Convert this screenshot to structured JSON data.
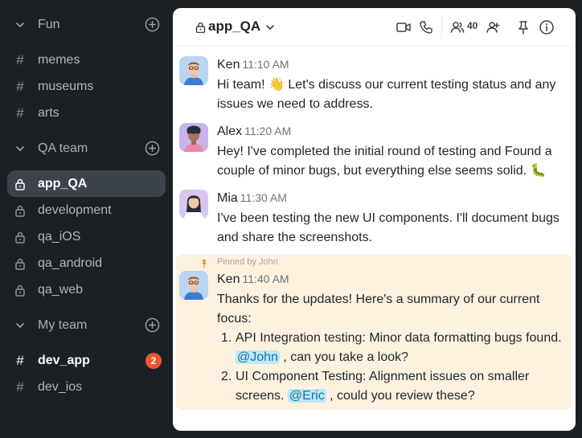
{
  "sidebar": {
    "sections": [
      {
        "title": "Fun",
        "channels": [
          {
            "name": "memes",
            "type": "public"
          },
          {
            "name": "museums",
            "type": "public"
          },
          {
            "name": "arts",
            "type": "public"
          }
        ]
      },
      {
        "title": "QA team",
        "channels": [
          {
            "name": "app_QA",
            "type": "private",
            "active": true
          },
          {
            "name": "development",
            "type": "private"
          },
          {
            "name": "qa_iOS",
            "type": "private"
          },
          {
            "name": "qa_android",
            "type": "private"
          },
          {
            "name": "qa_web",
            "type": "private"
          }
        ]
      },
      {
        "title": "My team",
        "channels": [
          {
            "name": "dev_app",
            "type": "public",
            "unread": "2"
          },
          {
            "name": "dev_ios",
            "type": "public"
          }
        ]
      }
    ]
  },
  "header": {
    "channel_name": "app_QA",
    "member_count": "40",
    "icons": [
      "lock-icon",
      "chevron-down-icon",
      "video-icon",
      "phone-icon",
      "members-icon",
      "add-member-icon",
      "pin-icon",
      "info-icon"
    ]
  },
  "messages": [
    {
      "author": "Ken",
      "time": "11:10 AM",
      "text": "Hi team! 👋 Let's discuss our current testing status and any issues we need to address."
    },
    {
      "author": "Alex",
      "time": "11:20 AM",
      "text": "Hey! I've completed the initial round of testing and Found a couple of minor bugs, but everything else seems solid. 🐛"
    },
    {
      "author": "Mia",
      "time": "11:30 AM",
      "text": "I've been testing the new UI components. I'll document bugs and share the screenshots."
    }
  ],
  "pinned_message": {
    "pinned_label": "Pinned by John",
    "author": "Ken",
    "time": "11:40 AM",
    "intro": "Thanks for the updates! Here's a summary of our current focus:",
    "items": [
      {
        "num": "1.",
        "before": "API Integration testing: Minor data formatting bugs found. ",
        "mention": "@John",
        "after": " , can you take a look?"
      },
      {
        "num": "2.",
        "before": "UI Component Testing: Alignment issues on smaller screens. ",
        "mention": "@Eric",
        "after": " , could you review these?"
      }
    ]
  },
  "colors": {
    "sidebar_bg": "#1b2025",
    "active_channel_bg": "#3c434a",
    "badge": "#f2542d",
    "pinned_bg": "#fdf1e0",
    "mention_bg": "#bfe6f7",
    "mention_text": "#1277a6",
    "pin_accent": "#f28c28"
  }
}
